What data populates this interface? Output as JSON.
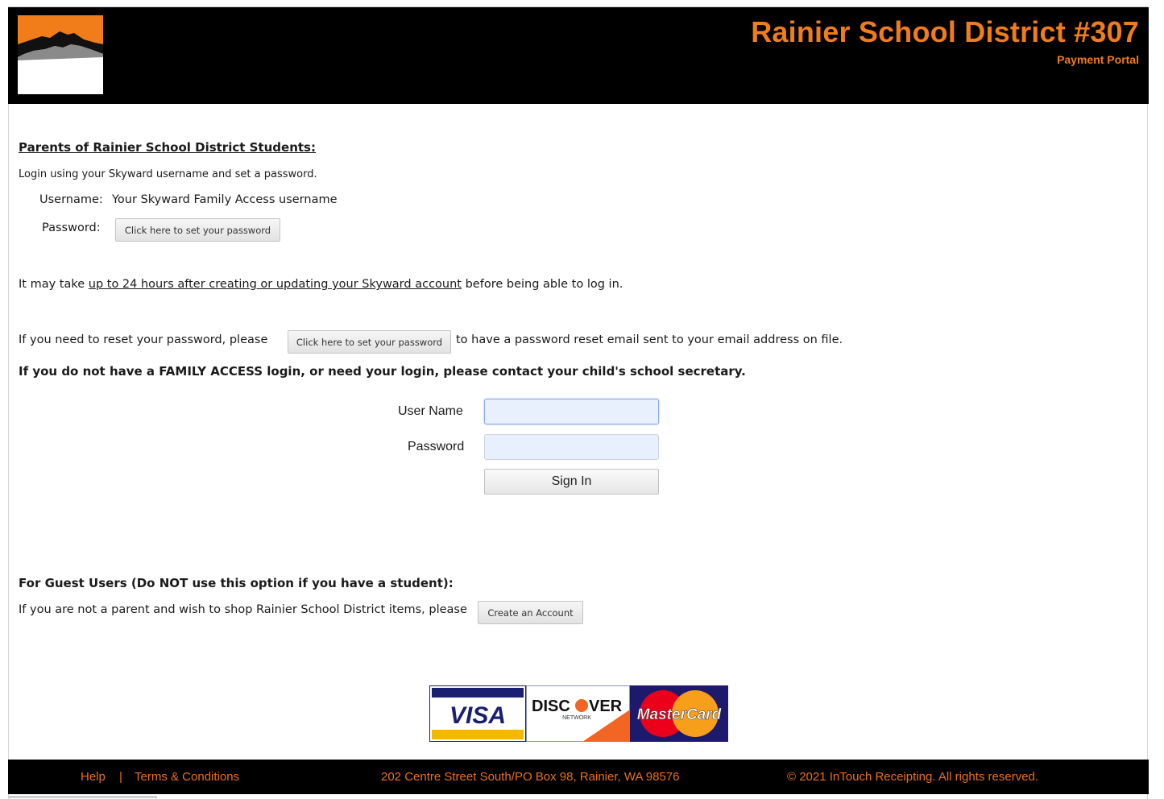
{
  "header": {
    "title": "Rainier School District #307",
    "subtitle": "Payment Portal",
    "logo_icon": "mountain-logo-icon",
    "accent_color": "#f07c1a"
  },
  "parents": {
    "heading": "Parents of Rainier School District Students:",
    "instructions": "Login using your Skyward username and set a password.",
    "username_label": "Username:",
    "username_value": "Your Skyward Family Access username",
    "password_label": "Password:",
    "set_password_button": "Click here to set your password"
  },
  "notice": {
    "prefix": "It may take ",
    "link": "up to 24 hours after creating or updating your Skyward account",
    "suffix": " before being able to log in."
  },
  "reset": {
    "prefix": "If you need to reset your password, please",
    "button": "Click here to set your password",
    "suffix": "to have a password reset email sent to your email address on file."
  },
  "family_access_notice": "If you do not have a FAMILY ACCESS login, or need your login, please contact your child's school secretary.",
  "login_form": {
    "username_label": "User Name",
    "username_value": "",
    "password_label": "Password",
    "password_value": "",
    "sign_in_button": "Sign In"
  },
  "guest": {
    "heading": "For Guest Users (Do NOT use this option if you have a student):",
    "text": "If you are not a parent and wish to shop Rainier School District items, please",
    "create_account_button": "Create an Account"
  },
  "cards": {
    "visa": "VISA",
    "discover_pre": "DISC",
    "discover_post": "VER",
    "discover_sub": "NETWORK",
    "mastercard": "MasterCard"
  },
  "footer": {
    "help": "Help",
    "separator": "|",
    "terms": "Terms & Conditions",
    "address": "202 Centre Street South/PO Box 98, Rainier, WA 98576",
    "copyright": "© 2021 InTouch Receipting. All rights reserved."
  }
}
